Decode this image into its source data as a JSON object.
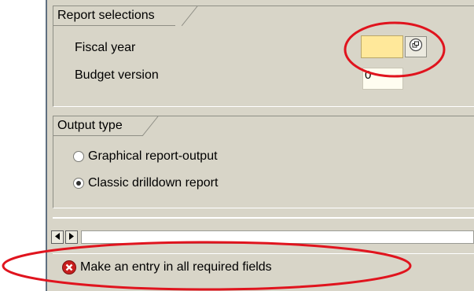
{
  "report_selections": {
    "title": "Report selections",
    "fiscal_year_label": "Fiscal year",
    "fiscal_year_value": "",
    "budget_version_label": "Budget version",
    "budget_version_value": "0"
  },
  "output_type": {
    "title": "Output type",
    "options": [
      {
        "label": "Graphical report-output",
        "selected": false
      },
      {
        "label": "Classic drilldown report",
        "selected": true
      }
    ]
  },
  "status": {
    "message": "Make an entry in all required fields",
    "icon": "error-icon",
    "type": "error"
  },
  "icons": {
    "value_help": "value-help-icon",
    "scroll_left": "scroll-left-icon",
    "scroll_right": "scroll-right-icon"
  },
  "colors": {
    "required_field": "#ffe89a",
    "annotation": "#e0141e",
    "error": "#c81e1e"
  }
}
